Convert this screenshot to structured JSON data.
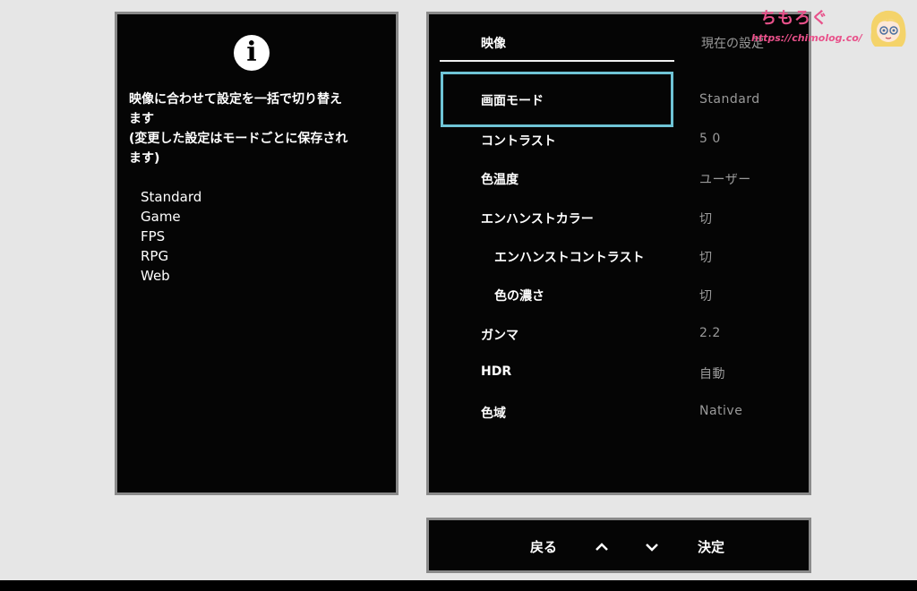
{
  "info": {
    "description": "映像に合わせて設定を一括で切り替え\nます\n(変更した設定はモードごとに保存され\nます)",
    "modes": [
      "Standard",
      "Game",
      "FPS",
      "RPG",
      "Web"
    ]
  },
  "tabs": {
    "active": "映像",
    "inactive": "現在の設定"
  },
  "menu": [
    {
      "label": "画面モード",
      "value": "Standard"
    },
    {
      "label": "コントラスト",
      "value": "5 0"
    },
    {
      "label": "色温度",
      "value": "ユーザー"
    },
    {
      "label": "エンハンストカラー",
      "value": "切"
    },
    {
      "label": "エンハンストコントラスト",
      "value": "切"
    },
    {
      "label": "色の濃さ",
      "value": "切"
    },
    {
      "label": "ガンマ",
      "value": "2.2"
    },
    {
      "label": "HDR",
      "value": "自動"
    },
    {
      "label": "色域",
      "value": "Native"
    }
  ],
  "nav": {
    "back": "戻る",
    "confirm": "決定"
  },
  "watermark": {
    "title": "ちもろぐ",
    "url": "https://chimolog.co/"
  },
  "colors": {
    "selection_border": "#6fc4d6",
    "watermark": "#e8518a"
  }
}
